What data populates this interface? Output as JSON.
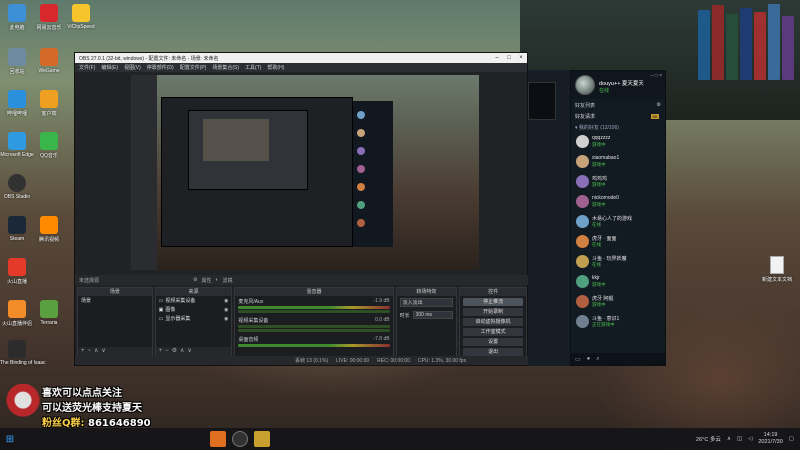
{
  "desktop": {
    "icons": [
      {
        "label": "此电脑",
        "color": "#3d8fd6"
      },
      {
        "label": "网易云音乐",
        "color": "#d7282e"
      },
      {
        "label": "ViClipSpeed",
        "color": "#f5c52b"
      },
      {
        "label": "回收站",
        "color": "#6e8aa0"
      },
      {
        "label": "WeGame",
        "color": "#d36a2a"
      },
      {
        "label": "斗鱼",
        "color": "#f2c94c"
      },
      {
        "label": "哔哩哔哩",
        "color": "#2a8fdc"
      },
      {
        "label": "客户端",
        "color": "#f0a020"
      },
      {
        "label": "Microsoft Edge",
        "color": "#2e9be0"
      },
      {
        "label": "QQ音乐",
        "color": "#39b54a"
      },
      {
        "label": "OBS Studio",
        "color": "#323232"
      },
      {
        "label": "Steam",
        "color": "#1b2838"
      },
      {
        "label": "腾讯视频",
        "color": "#ff8a00"
      },
      {
        "label": "火山直播",
        "color": "#e33a2a"
      },
      {
        "label": "火山直播伴侣",
        "color": "#f28c28"
      },
      {
        "label": "The Binding of Isaac",
        "color": "#2c2c2c"
      },
      {
        "label": "Terraria",
        "color": "#5aa040"
      }
    ],
    "file_label": "新建文本文档"
  },
  "obs": {
    "title": "OBS 27.0.1 (32-bit, windows) - 配置文件: 未命名 - 场景: 未命名",
    "menu": [
      "文件(F)",
      "编辑(E)",
      "视图(V)",
      "停靠部件(D)",
      "配置文件(P)",
      "场景集合(S)",
      "工具(T)",
      "帮助(H)"
    ],
    "no_source": "未选择源",
    "props_label": "属性",
    "filters_label": "滤镜",
    "docks": {
      "scenes": {
        "title": "场景",
        "items": [
          "场景"
        ]
      },
      "sources": {
        "title": "来源",
        "items": [
          "视频采集设备",
          "图像",
          "显示器采集"
        ]
      },
      "mixer": {
        "title": "混音器",
        "channels": [
          {
            "name": "麦克风/Aux",
            "db": "-1.9 dB",
            "level": 0.7
          },
          {
            "name": "视频采集设备",
            "db": "0.0 dB",
            "level": 0.2
          },
          {
            "name": "桌面音频",
            "db": "-7.8 dB",
            "level": 0.6
          }
        ]
      },
      "transitions": {
        "title": "转场特效",
        "type": "淡入淡出",
        "duration_label": "时长",
        "duration": "300 ms"
      },
      "controls": {
        "title": "控件",
        "buttons": [
          "停止推流",
          "开始录制",
          "启动虚拟摄像机",
          "工作室模式",
          "设置",
          "退出"
        ]
      }
    },
    "status": {
      "live": "LIVE: 00:00:00",
      "rec": "REC: 00:00:00",
      "cpu": "CPU: 1.3%, 30.00 fps",
      "dropped": "丢帧 13 (0.1%)",
      "bitrate": "kb/s: 2345"
    }
  },
  "chat": {
    "user": "douyu++ 夏天夏天",
    "status": "在线",
    "tab": "好友列表",
    "section": "好友请求",
    "section_badge": "99",
    "group": "▾ 我的好友 (12/106)",
    "contacts": [
      {
        "name": "qqqzzzz",
        "status": "游戏中",
        "color": "#d0d0d0"
      },
      {
        "name": "xiaomabao1",
        "status": "游戏中",
        "color": "#c7a37a"
      },
      {
        "name": "鸡鸡鸡",
        "status": "游戏中",
        "color": "#8a6fb8"
      },
      {
        "name": "nickomode0",
        "status": "游戏中",
        "color": "#a06090"
      },
      {
        "name": "木易心人了的游戏",
        "status": "在线",
        "color": "#6fa0c8"
      },
      {
        "name": "虎牙 · 面面",
        "status": "在线",
        "color": "#d08040"
      },
      {
        "name": "斗鱼 · 玩界妖魔",
        "status": "在线",
        "color": "#c0a050"
      },
      {
        "name": "kkjr",
        "status": "游戏中",
        "color": "#50a080"
      },
      {
        "name": "虎牙 阿鲲",
        "status": "游戏中",
        "color": "#b06040"
      },
      {
        "name": "斗鱼 · 意识1",
        "status": "正在游戏中",
        "color": "#708090"
      }
    ]
  },
  "overlay": {
    "line1": "喜欢可以点点关注",
    "line2": "可以送荧光棒支持夏天",
    "fans_label": "粉丝Q群:",
    "fans_number": "861646890"
  },
  "taskbar": {
    "weather": "26°C 多云",
    "clock_time": "14:19",
    "clock_date": "2021/7/30"
  }
}
